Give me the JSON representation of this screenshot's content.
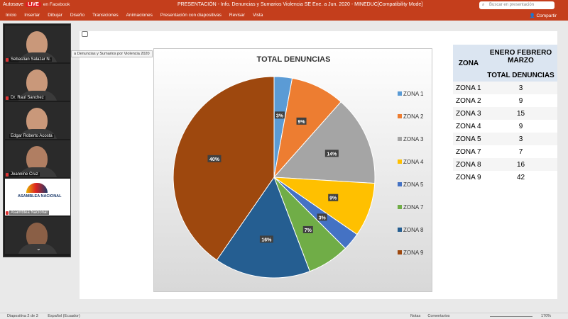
{
  "titlebar": {
    "left_label": "Autosave",
    "live": "LIVE",
    "facebook": "en Facebook",
    "title": "PRESENTACIÓN - Info. Denuncias y Sumarios Violencia SE Ene. a Jun. 2020 - MINEDUC[Compatibility Mode]",
    "search_placeholder": "Buscar en presentación"
  },
  "menu": {
    "items": [
      "Inicio",
      "Insertar",
      "Dibujar",
      "Diseño",
      "Transiciones",
      "Animaciones",
      "Presentación con diapositivas",
      "Revisar",
      "Vista"
    ],
    "share": "Compartir"
  },
  "tooltip": "a Denuncias y Sumarios por Violencia 2020",
  "participants": [
    {
      "name": "Sebastian Salazar N."
    },
    {
      "name": "Dr. Raul Sanchez"
    },
    {
      "name": "Edgar Roberto Acosta"
    },
    {
      "name": "Jeannine Cruz"
    },
    {
      "name": "Asamblea Nacional",
      "logo_text": "ASAMBLEA NACIONAL"
    },
    {
      "name": ""
    }
  ],
  "chart_data": {
    "type": "pie",
    "title": "TOTAL DENUNCIAS",
    "categories": [
      "ZONA 1",
      "ZONA 2",
      "ZONA 3",
      "ZONA 4",
      "ZONA 5",
      "ZONA 7",
      "ZONA 8",
      "ZONA 9"
    ],
    "values": [
      3,
      9,
      15,
      9,
      3,
      7,
      16,
      42
    ],
    "data_labels": [
      "3%",
      "9%",
      "14%",
      "9%",
      "3%",
      "7%",
      "16%",
      "40%"
    ],
    "colors": [
      "#5b9bd5",
      "#ed7d31",
      "#a5a5a5",
      "#ffc000",
      "#4472c4",
      "#70ad47",
      "#255e91",
      "#9e480e"
    ],
    "legend": "right"
  },
  "table": {
    "header_col1": "ZONA",
    "header_col2_line1": "ENERO FEBRERO MARZO",
    "header_col2_line2": "TOTAL DENUNCIAS",
    "rows": [
      {
        "zona": "ZONA 1",
        "total": "3"
      },
      {
        "zona": "ZONA 2",
        "total": "9"
      },
      {
        "zona": "ZONA 3",
        "total": "15"
      },
      {
        "zona": "ZONA 4",
        "total": "9"
      },
      {
        "zona": "ZONA 5",
        "total": "3"
      },
      {
        "zona": "ZONA 7",
        "total": "7"
      },
      {
        "zona": "ZONA 8",
        "total": "16"
      },
      {
        "zona": "ZONA 9",
        "total": "42"
      }
    ]
  },
  "status": {
    "slide": "Diapositiva 2 de 3",
    "language": "Español (Ecuador)",
    "notes": "Notas",
    "comments": "Comentarios",
    "zoom": "170%"
  }
}
